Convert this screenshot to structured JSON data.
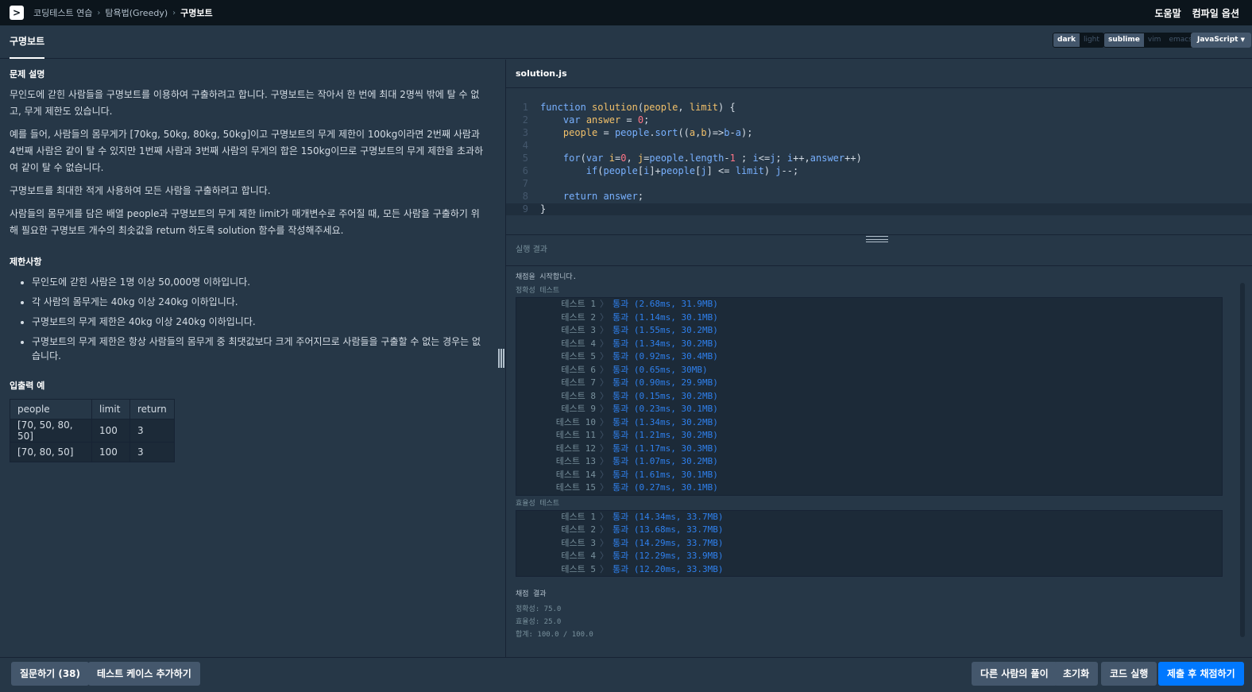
{
  "breadcrumb": [
    "코딩테스트 연습",
    "탐욕법(Greedy)",
    "구명보트"
  ],
  "top_nav": {
    "help": "도움말",
    "compile_options": "컴파일 옵션"
  },
  "tab": {
    "title": "구명보트"
  },
  "editor_options": {
    "theme": [
      "dark",
      "light"
    ],
    "theme_selected": "dark",
    "keymap": [
      "sublime",
      "vim",
      "emacs"
    ],
    "keymap_selected": "sublime",
    "language": "JavaScript"
  },
  "problem": {
    "section_title": "문제 설명",
    "paragraphs": [
      "무인도에 갇힌 사람들을 구명보트를 이용하여 구출하려고 합니다. 구명보트는 작아서 한 번에 최대 2명씩 밖에 탈 수 없고, 무게 제한도 있습니다.",
      "예를 들어, 사람들의 몸무게가 [70kg, 50kg, 80kg, 50kg]이고 구명보트의 무게 제한이 100kg이라면 2번째 사람과 4번째 사람은 같이 탈 수 있지만 1번째 사람과 3번째 사람의 무게의 합은 150kg이므로 구명보트의 무게 제한을 초과하여 같이 탈 수 없습니다.",
      "구명보트를 최대한 적게 사용하여 모든 사람을 구출하려고 합니다.",
      "사람들의 몸무게를 담은 배열 people과 구명보트의 무게 제한 limit가 매개변수로 주어질 때, 모든 사람을 구출하기 위해 필요한 구명보트 개수의 최솟값을 return 하도록 solution 함수를 작성해주세요."
    ],
    "constraints_title": "제한사항",
    "constraints": [
      "무인도에 갇힌 사람은 1명 이상 50,000명 이하입니다.",
      "각 사람의 몸무게는 40kg 이상 240kg 이하입니다.",
      "구명보트의 무게 제한은 40kg 이상 240kg 이하입니다.",
      "구명보트의 무게 제한은 항상 사람들의 몸무게 중 최댓값보다 크게 주어지므로 사람들을 구출할 수 없는 경우는 없습니다."
    ],
    "examples_title": "입출력 예",
    "examples_headers": [
      "people",
      "limit",
      "return"
    ],
    "examples": [
      [
        "[70, 50, 80, 50]",
        "100",
        "3"
      ],
      [
        "[70, 80, 50]",
        "100",
        "3"
      ]
    ]
  },
  "editor": {
    "filename": "solution.js",
    "line_numbers": [
      "1",
      "2",
      "3",
      "4",
      "5",
      "6",
      "7",
      "8",
      "9"
    ]
  },
  "result": {
    "header": "실행 결과",
    "start_message": "채점을 시작합니다.",
    "accuracy_label": "정확성  테스트",
    "accuracy_tests": [
      [
        "테스트 1",
        "통과 (2.68ms, 31.9MB)"
      ],
      [
        "테스트 2",
        "통과 (1.14ms, 30.1MB)"
      ],
      [
        "테스트 3",
        "통과 (1.55ms, 30.2MB)"
      ],
      [
        "테스트 4",
        "통과 (1.34ms, 30.2MB)"
      ],
      [
        "테스트 5",
        "통과 (0.92ms, 30.4MB)"
      ],
      [
        "테스트 6",
        "통과 (0.65ms, 30MB)"
      ],
      [
        "테스트 7",
        "통과 (0.90ms, 29.9MB)"
      ],
      [
        "테스트 8",
        "통과 (0.15ms, 30.2MB)"
      ],
      [
        "테스트 9",
        "통과 (0.23ms, 30.1MB)"
      ],
      [
        "테스트 10",
        "통과 (1.34ms, 30.2MB)"
      ],
      [
        "테스트 11",
        "통과 (1.21ms, 30.2MB)"
      ],
      [
        "테스트 12",
        "통과 (1.17ms, 30.3MB)"
      ],
      [
        "테스트 13",
        "통과 (1.07ms, 30.2MB)"
      ],
      [
        "테스트 14",
        "통과 (1.61ms, 30.1MB)"
      ],
      [
        "테스트 15",
        "통과 (0.27ms, 30.1MB)"
      ]
    ],
    "efficiency_label": "효율성  테스트",
    "efficiency_tests": [
      [
        "테스트 1",
        "통과 (14.34ms, 33.7MB)"
      ],
      [
        "테스트 2",
        "통과 (13.68ms, 33.7MB)"
      ],
      [
        "테스트 3",
        "통과 (14.29ms, 33.7MB)"
      ],
      [
        "테스트 4",
        "통과 (12.29ms, 33.9MB)"
      ],
      [
        "테스트 5",
        "통과 (12.20ms, 33.3MB)"
      ]
    ],
    "summary_title": "채점 결과",
    "summary": [
      "정확성: 75.0",
      "효율성: 25.0",
      "합계: 100.0 / 100.0"
    ]
  },
  "bottom": {
    "question": "질문하기 (38)",
    "add_testcase": "테스트 케이스 추가하기",
    "others_solution": "다른 사람의 풀이",
    "reset": "초기화",
    "run": "코드 실행",
    "submit": "제출 후 채점하기"
  },
  "colors": {
    "accent": "#0078ff",
    "pass": "#2f80ed",
    "bg": "#263747",
    "nav": "#0c151c"
  }
}
